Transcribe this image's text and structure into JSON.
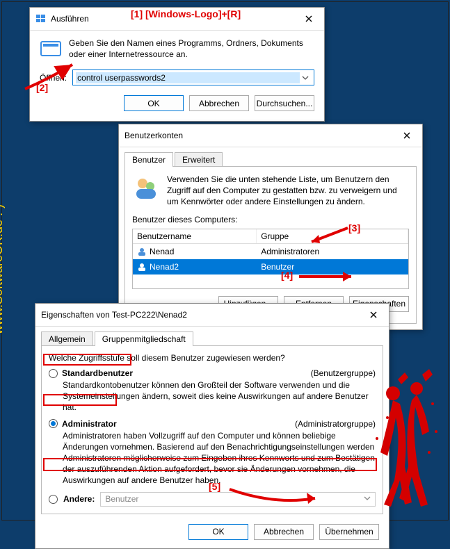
{
  "annotations": {
    "a1": "[1] [Windows-Logo]+[R]",
    "a2": "[2]",
    "a3": "[3]",
    "a4": "[4]",
    "a5": "[5]"
  },
  "watermark": "www.SoftwareOK.de  :-)",
  "run": {
    "title": "Ausführen",
    "desc": "Geben Sie den Namen eines Programms, Ordners, Dokuments oder einer Internetressource an.",
    "open_label": "Öffnen:",
    "command_value": "control userpasswords2",
    "ok": "OK",
    "cancel": "Abbrechen",
    "browse": "Durchsuchen..."
  },
  "accounts": {
    "title": "Benutzerkonten",
    "tab_users": "Benutzer",
    "tab_advanced": "Erweitert",
    "intro": "Verwenden Sie die unten stehende Liste, um Benutzern den Zugriff auf den Computer zu gestatten bzw. zu verweigern und um Kennwörter oder andere Einstellungen zu ändern.",
    "list_label": "Benutzer dieses Computers:",
    "col_user": "Benutzername",
    "col_group": "Gruppe",
    "rows": [
      {
        "name": "Nenad",
        "group": "Administratoren"
      },
      {
        "name": "Nenad2",
        "group": "Benutzer"
      }
    ],
    "add": "Hinzufügen...",
    "remove": "Entfernen",
    "props": "Eigenschaften"
  },
  "props": {
    "title": "Eigenschaften von Test-PC222\\Nenad2",
    "tab_general": "Allgemein",
    "tab_membership": "Gruppenmitgliedschaft",
    "question": "Welche Zugriffsstufe soll diesem Benutzer zugewiesen werden?",
    "std_label": "Standardbenutzer",
    "std_group": "(Benutzergruppe)",
    "std_desc": "Standardkontobenutzer können den Großteil der Software verwenden und die Systemeinstellungen ändern, soweit dies keine Auswirkungen auf andere Benutzer hat.",
    "admin_label": "Administrator",
    "admin_group": "(Administratorgruppe)",
    "admin_desc": "Administratoren haben Vollzugriff auf den Computer und können beliebige Änderungen vornehmen. Basierend auf den Benachrichtigungseinstellungen werden Administratoren möglicherweise zum Eingeben ihres Kennworts und zum Bestätigen der auszuführenden Aktion aufgefordert, bevor sie Änderungen vornehmen, die Auswirkungen auf andere Benutzer haben.",
    "other_label": "Andere:",
    "other_value": "Benutzer",
    "ok": "OK",
    "cancel": "Abbrechen",
    "apply": "Übernehmen"
  }
}
